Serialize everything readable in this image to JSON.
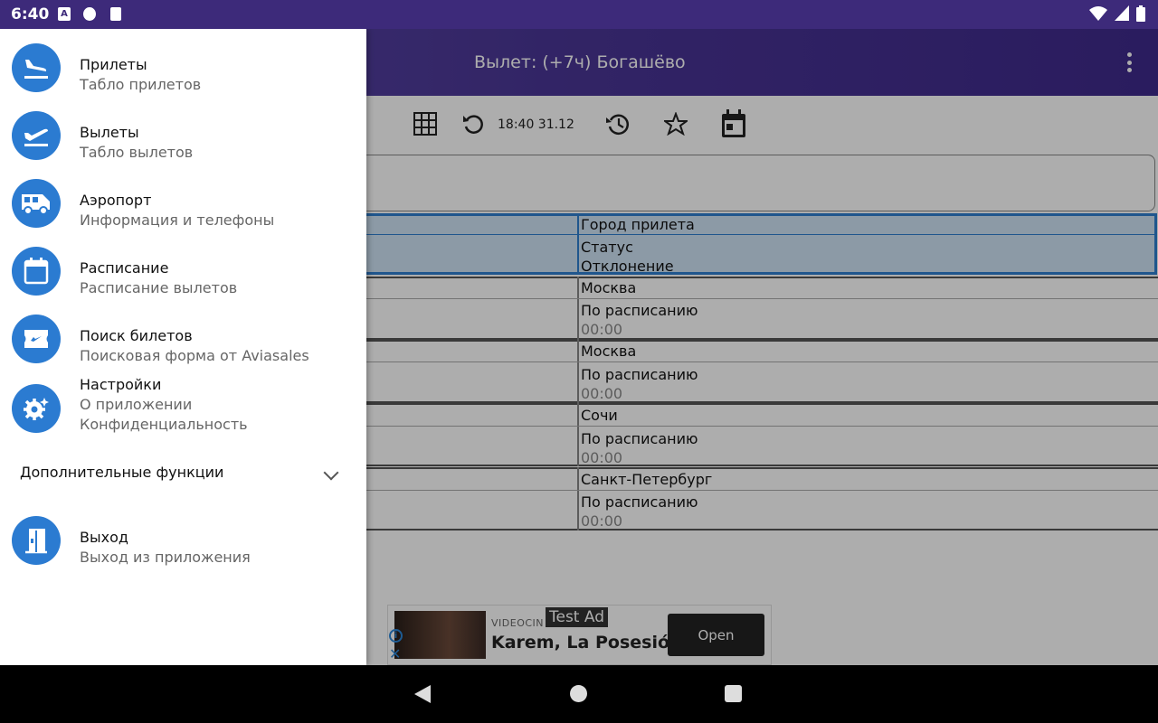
{
  "status_bar": {
    "time": "6:40",
    "icon_a": "A"
  },
  "app_bar": {
    "title": "Вылет: (+7ч) Богашёво"
  },
  "toolbar": {
    "time_label": "18:40 31.12"
  },
  "table": {
    "header": {
      "city_label": "Город прилета",
      "status_label": "Статус",
      "deviation_label": "Отклонение"
    },
    "rows": [
      {
        "city": "Москва",
        "status": "По расписанию",
        "deviation": "00:00"
      },
      {
        "city": "Москва",
        "status": "По расписанию",
        "deviation": "00:00"
      },
      {
        "city": "Сочи",
        "status": "По расписанию",
        "deviation": "00:00"
      },
      {
        "city": "Санкт-Петербург",
        "status": "По расписанию",
        "deviation": "00:00"
      }
    ]
  },
  "ad": {
    "label": "Test Ad",
    "brand": "VIDEOCIN",
    "title": "Karem, La Posesión",
    "button": "Open"
  },
  "drawer": {
    "items": [
      {
        "title": "Прилеты",
        "subtitle": "Табло прилетов",
        "icon": "flight-land-icon"
      },
      {
        "title": "Вылеты",
        "subtitle": "Табло вылетов",
        "icon": "flight-takeoff-icon"
      },
      {
        "title": "Аэропорт",
        "subtitle": "Информация и телефоны",
        "icon": "bus-icon"
      },
      {
        "title": "Расписание",
        "subtitle": "Расписание вылетов",
        "icon": "calendar-icon"
      },
      {
        "title": "Поиск билетов",
        "subtitle": "Поисковая форма от Aviasales",
        "icon": "ticket-icon"
      },
      {
        "title": "Настройки",
        "subtitle": "О приложении",
        "subtitle2": "Конфиденциальность",
        "icon": "settings-icon"
      }
    ],
    "extra_label": "Дополнительные функции",
    "exit": {
      "title": "Выход",
      "subtitle": "Выход из приложения",
      "icon": "exit-door-icon"
    }
  },
  "colors": {
    "accent": "#2b7bd1",
    "appbar": "#4a3596",
    "header_highlight": "#cfe3f5"
  }
}
